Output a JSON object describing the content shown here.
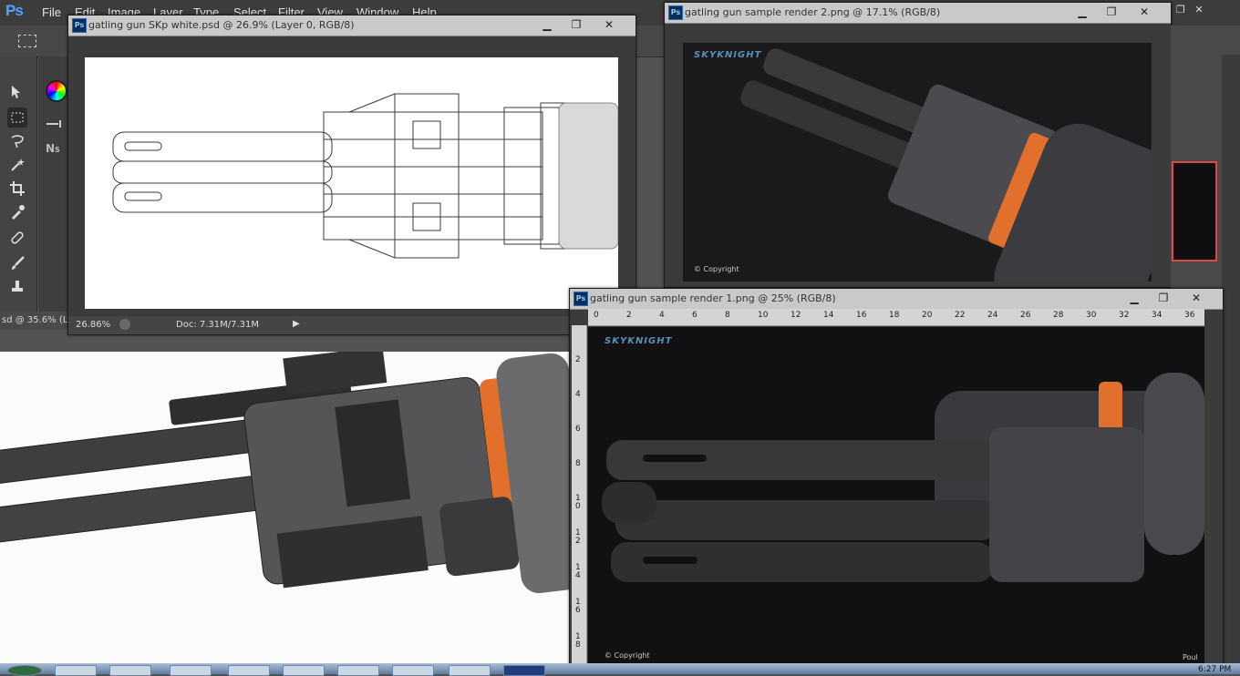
{
  "app": {
    "logo": "Ps"
  },
  "menu": [
    "File",
    "Edit",
    "Image",
    "Layer",
    "Type",
    "Select",
    "Filter",
    "View",
    "Window",
    "Help"
  ],
  "windows": [
    {
      "title": "gatling gun SKp white.psd @ 26.9% (Layer 0, RGB/8)",
      "zoom": "26.86%",
      "doc_size": "Doc: 7.31M/7.31M"
    },
    {
      "title": "gatling gun sample render 2.png @ 17.1% (RGB/8)",
      "watermark": "SKYKNIGHT",
      "copyright": "© Copyright"
    },
    {
      "title": "gatling gun sample render 1.png @ 25% (RGB/8)",
      "watermark": "SKYKNIGHT",
      "copyright": "© Copyright",
      "corner_text": "Poul",
      "ruler_h": [
        "0",
        "2",
        "4",
        "6",
        "8",
        "10",
        "12",
        "14",
        "16",
        "18",
        "20",
        "22",
        "24",
        "26",
        "28",
        "30",
        "32",
        "34",
        "36"
      ],
      "ruler_v": [
        "2",
        "4",
        "6",
        "8",
        "1\n0",
        "1\n2",
        "1\n4",
        "1\n6",
        "1\n8"
      ]
    }
  ],
  "background_doc": {
    "title_fragment": "sd @ 35.6% (L"
  },
  "window_controls": {
    "minimize": "▁",
    "restore": "❐",
    "close": "✕"
  },
  "taskbar": {
    "clock": "6:27 PM"
  },
  "tools": [
    "move-tool",
    "marquee-tool",
    "lasso-tool",
    "magic-wand-tool",
    "crop-tool",
    "eyedropper-tool",
    "healing-brush-tool",
    "brush-tool",
    "stamp-tool"
  ],
  "colors": {
    "orange_accent": "#e2702c",
    "ps_blue": "#4fa3ff"
  }
}
